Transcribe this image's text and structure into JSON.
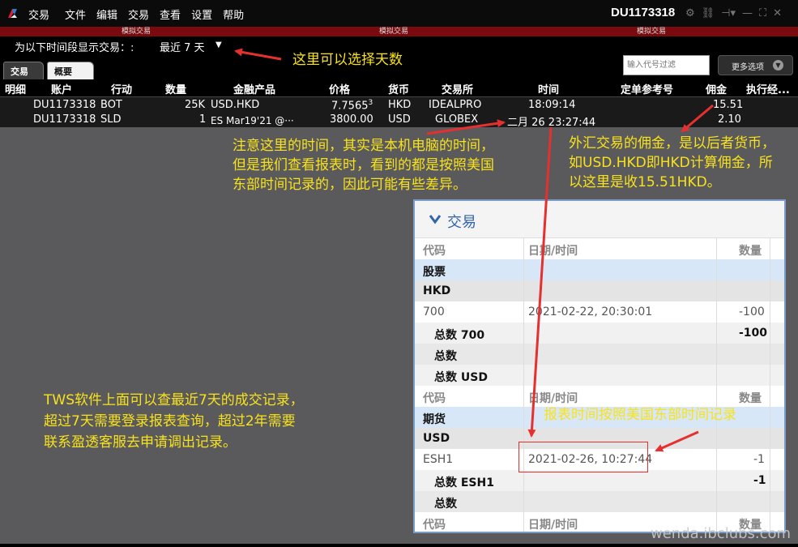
{
  "titlebar": {
    "app_title": "交易",
    "menu": [
      "文件",
      "编辑",
      "交易",
      "查看",
      "设置",
      "帮助"
    ],
    "account": "DU1173318"
  },
  "sim_banner": [
    "模拟交易",
    "模拟交易",
    "模拟交易"
  ],
  "period": {
    "label": "为以下时间段显示交易：:",
    "value": "最近 7 天"
  },
  "tabs": [
    "交易",
    "概要"
  ],
  "filter": {
    "placeholder": "输入代号过滤"
  },
  "more_options": "更多选项",
  "columns": [
    "明细",
    "账户",
    "行动",
    "数量",
    "金融产品",
    "价格",
    "货币",
    "交易所",
    "时间",
    "定单参考号",
    "佣金",
    "执行经..."
  ],
  "trades": [
    {
      "account": "DU1173318",
      "action": "BOT",
      "qty": "25K",
      "product": "USD.HKD",
      "price": "7.7565",
      "price_sup": "3",
      "currency": "HKD",
      "exchange": "IDEALPRO",
      "time": "18:09:14",
      "commission": "15.51"
    },
    {
      "account": "DU1173318",
      "action": "SLD",
      "qty": "1",
      "product": "ES Mar19'21 @···",
      "price": "3800.00",
      "price_sup": "",
      "currency": "USD",
      "exchange": "GLOBEX",
      "time": "二月 26 23:27:44",
      "commission": "2.10"
    }
  ],
  "notes": {
    "days": "这里可以选择天数",
    "time_1": "注意这里的时间，其实是本机电脑的时间，",
    "time_2": "但是我们查看报表时，看到的都是按照美国",
    "time_3": "东部时间记录的，因此可能有些差异。",
    "fx_1": "外汇交易的佣金，是以后者货币，",
    "fx_2": "如USD.HKD即HKD计算佣金，所",
    "fx_3": "以这里是收15.51HKD。",
    "tws_1": "TWS软件上面可以查最近7天的成交记录，",
    "tws_2": "超过7天需要登录报表查询，超过2年需要",
    "tws_3": "联系盈透客服去申请调出记录。",
    "report_time": "报表时间按照美国东部时间记录"
  },
  "report": {
    "title": "交易",
    "header": {
      "code": "代码",
      "datetime": "日期/时间",
      "qty": "数量"
    },
    "stocks": "股票",
    "hkd": "HKD",
    "row_700": {
      "code": "700",
      "datetime": "2021-02-22, 20:30:01",
      "qty": "-100"
    },
    "total_700": {
      "label": "总数 700",
      "qty": "-100"
    },
    "total": "总数",
    "total_usd": "总数 USD",
    "futures": "期货",
    "usd": "USD",
    "row_esh1": {
      "code": "ESH1",
      "datetime": "2021-02-26, 10:27:44",
      "qty": "-1"
    },
    "total_esh1": {
      "label": "总数 ESH1",
      "qty": "-1"
    },
    "total2": "总数"
  },
  "watermark": "wenda.ibclubs.com",
  "colors": {
    "annotation": "#f8e21c",
    "arrow": "#e53030",
    "sim_banner": "#7a0a0e"
  }
}
